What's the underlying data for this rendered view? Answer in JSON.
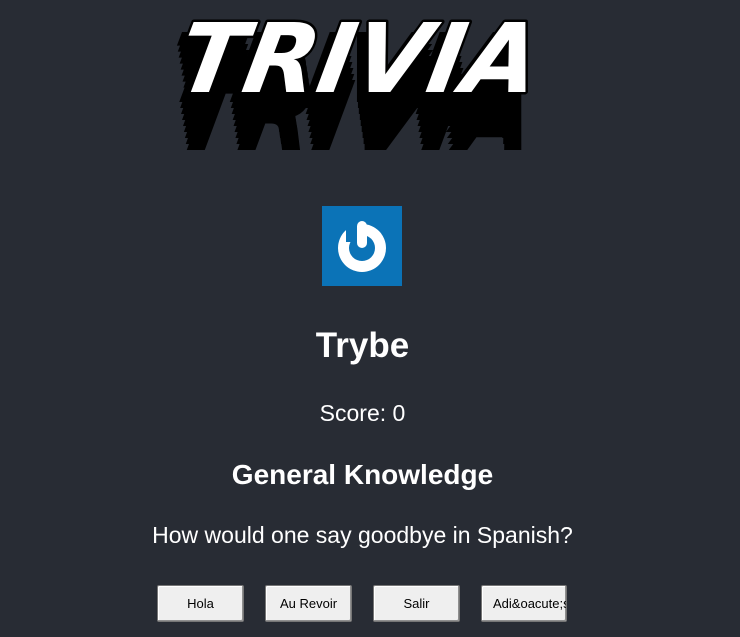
{
  "logo": {
    "text": "TRIVIA"
  },
  "player": {
    "name": "Trybe",
    "score_label": "Score: ",
    "score": "0"
  },
  "question": {
    "category": "General Knowledge",
    "text": "How would one say goodbye in Spanish?"
  },
  "answers": [
    {
      "label": "Hola"
    },
    {
      "label": "Au Revoir"
    },
    {
      "label": "Salir"
    },
    {
      "label": "Adi&oacute;s"
    }
  ],
  "colors": {
    "background": "#282c34",
    "avatar": "#0b73b7",
    "text": "#ffffff",
    "button_bg": "#efefef"
  },
  "icons": {
    "avatar": "power-icon"
  }
}
